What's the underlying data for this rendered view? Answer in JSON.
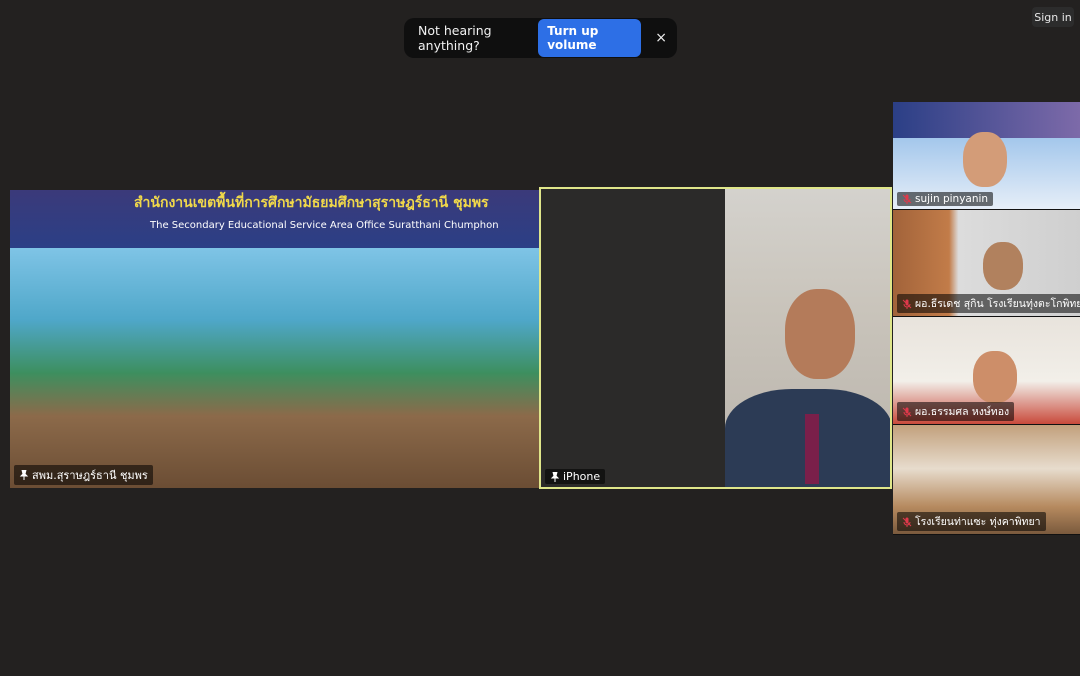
{
  "notification": {
    "message": "Not hearing anything?",
    "action_label": "Turn up volume",
    "close_symbol": "×"
  },
  "header": {
    "signin_label": "Sign in"
  },
  "main_tiles": [
    {
      "name": "สพม.สุราษฎร์ธานี ชุมพร",
      "banner_thai": "สำนักงานเขตพื้นที่การศึกษามัธยมศึกษาสุราษฎร์ธานี ชุมพร",
      "banner_eng": "The Secondary Educational Service Area Office Suratthani Chumphon",
      "pinned": true
    },
    {
      "name": "iPhone",
      "pinned": true,
      "active_speaker": true
    }
  ],
  "side_tiles": [
    {
      "name": "sujin pinyanin",
      "muted": true
    },
    {
      "name": "ผอ.ธีรเดช สุกิน โรงเรียนทุ่งตะโกพิทยาคม",
      "muted": true
    },
    {
      "name": "ผอ.ธรรมศล หงษ์ทอง",
      "muted": true
    },
    {
      "name": "โรงเรียนท่าแซะ ทุ่งคาพิทยา",
      "muted": true
    }
  ],
  "colors": {
    "background": "#232120",
    "action_button": "#2d6fe6",
    "active_border": "#dfe68a",
    "mute_icon": "#e0394b"
  }
}
